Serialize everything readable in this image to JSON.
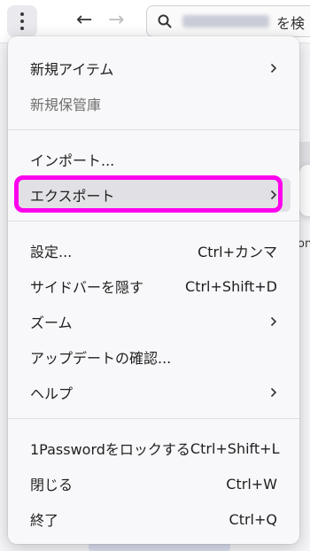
{
  "header": {
    "search_text": "を検"
  },
  "menu": {
    "new_item": {
      "label": "新規アイテム"
    },
    "new_vault": {
      "label": "新規保管庫"
    },
    "import": {
      "label": "インポート..."
    },
    "export": {
      "label": "エクスポート"
    },
    "settings": {
      "label": "設定...",
      "shortcut": "Ctrl+カンマ"
    },
    "hide_sidebar": {
      "label": "サイドバーを隠す",
      "shortcut": "Ctrl+Shift+D"
    },
    "zoom": {
      "label": "ズーム"
    },
    "check_updates": {
      "label": "アップデートの確認..."
    },
    "help": {
      "label": "ヘルプ"
    },
    "lock": {
      "label": "1Passwordをロックする",
      "shortcut": "Ctrl+Shift+L"
    },
    "close": {
      "label": "閉じる",
      "shortcut": "Ctrl+W"
    },
    "quit": {
      "label": "終了",
      "shortcut": "Ctrl+Q"
    }
  },
  "background": {
    "partial_text": "on"
  },
  "colors": {
    "annotation_highlight": "#ff00ee",
    "menu_background": "#f8f8fa",
    "hover_background": "#e1e1e5"
  }
}
